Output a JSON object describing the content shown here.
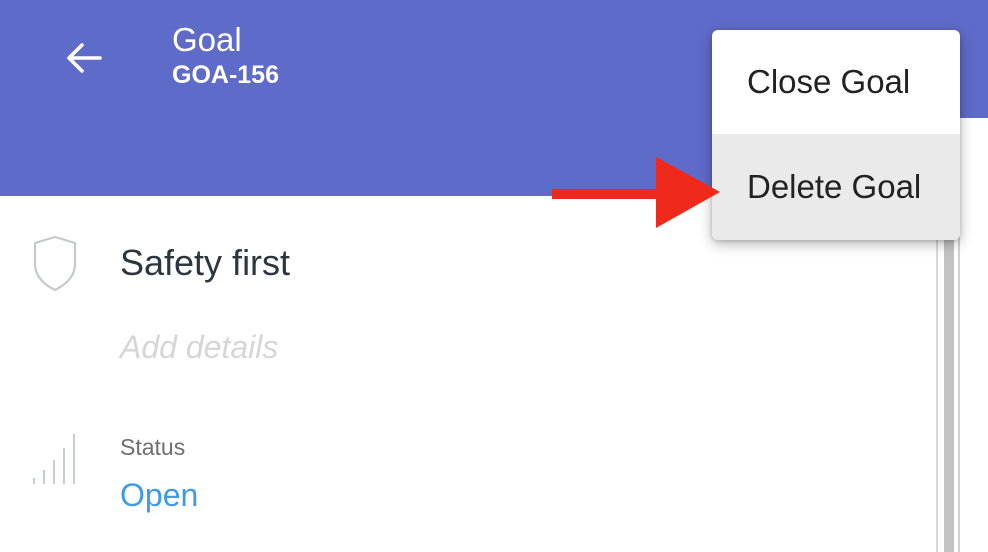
{
  "header": {
    "title": "Goal",
    "subtitle": "GOA-156",
    "background_color": "#5f6bc9",
    "back_icon": "arrow-left-icon"
  },
  "goal": {
    "title": "Safety first",
    "details_placeholder": "Add details",
    "icon": "shield-icon"
  },
  "status": {
    "label": "Status",
    "value": "Open",
    "value_color": "#3d9be9",
    "icon": "signal-bars-icon"
  },
  "menu": {
    "items": [
      {
        "label": "Close Goal"
      },
      {
        "label": "Delete Goal",
        "highlighted": true
      }
    ]
  },
  "annotation": {
    "icon": "red-arrow-icon",
    "color": "#f0291d"
  }
}
